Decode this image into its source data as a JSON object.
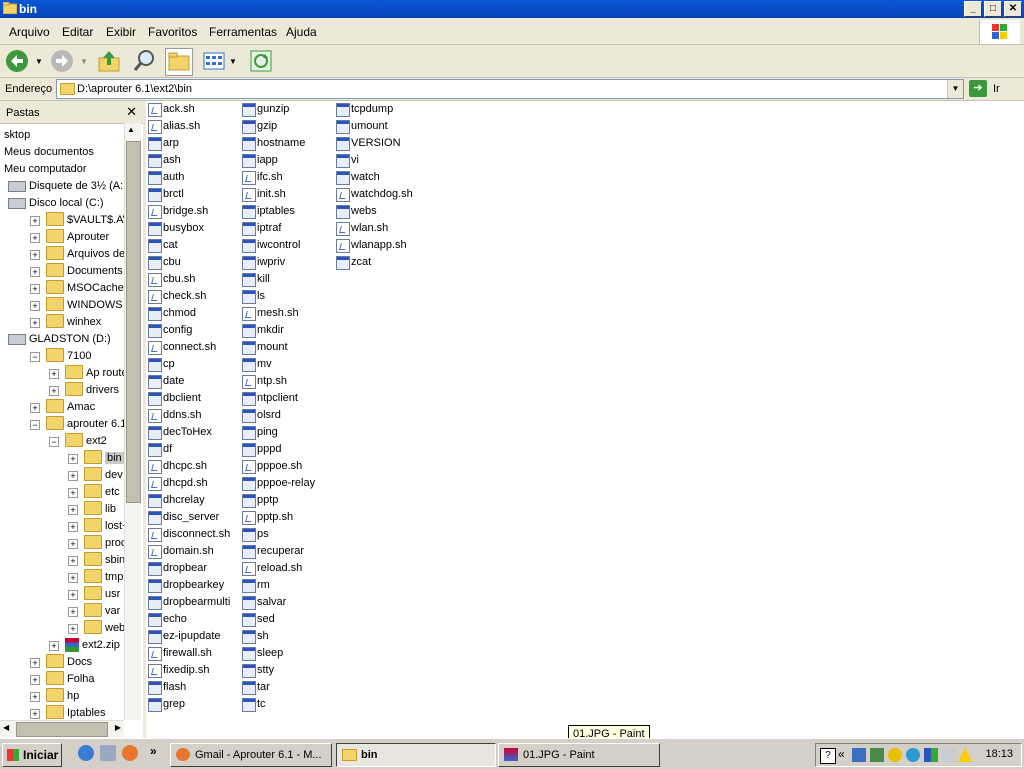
{
  "window": {
    "title": "bin",
    "btn_min": "_",
    "btn_max": "□",
    "btn_close": "✕"
  },
  "menu": [
    "Arquivo",
    "Editar",
    "Exibir",
    "Favoritos",
    "Ferramentas",
    "Ajuda"
  ],
  "address": {
    "label": "Endereço",
    "value": "D:\\aprouter 6.1\\ext2\\bin",
    "go_label": "Ir",
    "go_arrow": "➔"
  },
  "folders_pane": {
    "title": "Pastas",
    "close": "✕"
  },
  "tree": [
    {
      "label": "sktop",
      "indent": 0,
      "icon": "none",
      "exp": ""
    },
    {
      "label": "Meus documentos",
      "indent": 0,
      "icon": "none",
      "exp": ""
    },
    {
      "label": "Meu computador",
      "indent": 0,
      "icon": "none",
      "exp": ""
    },
    {
      "label": "Disquete de 3½ (A:",
      "indent": 1,
      "icon": "drive",
      "exp": ""
    },
    {
      "label": "Disco local (C:)",
      "indent": 1,
      "icon": "drive",
      "exp": ""
    },
    {
      "label": "$VAULT$.AVG",
      "indent": 2,
      "icon": "folder",
      "exp": "+"
    },
    {
      "label": "Aprouter",
      "indent": 2,
      "icon": "folder",
      "exp": "+"
    },
    {
      "label": "Arquivos de pro",
      "indent": 2,
      "icon": "folder",
      "exp": "+"
    },
    {
      "label": "Documents and",
      "indent": 2,
      "icon": "folder",
      "exp": "+"
    },
    {
      "label": "MSOCache",
      "indent": 2,
      "icon": "folder",
      "exp": "+"
    },
    {
      "label": "WINDOWS",
      "indent": 2,
      "icon": "folder",
      "exp": "+"
    },
    {
      "label": "winhex",
      "indent": 2,
      "icon": "folder",
      "exp": "+"
    },
    {
      "label": "GLADSTON (D:)",
      "indent": 1,
      "icon": "drive",
      "exp": ""
    },
    {
      "label": "7100",
      "indent": 2,
      "icon": "folder",
      "exp": "−"
    },
    {
      "label": "Ap router",
      "indent": 3,
      "icon": "folder",
      "exp": "+"
    },
    {
      "label": "drivers",
      "indent": 3,
      "icon": "folder",
      "exp": "+"
    },
    {
      "label": "Amac",
      "indent": 2,
      "icon": "folder",
      "exp": "+"
    },
    {
      "label": "aprouter 6.1",
      "indent": 2,
      "icon": "folder",
      "exp": "−"
    },
    {
      "label": "ext2",
      "indent": 3,
      "icon": "folder",
      "exp": "−"
    },
    {
      "label": "bin",
      "indent": 4,
      "icon": "folder",
      "exp": "+",
      "selected": true
    },
    {
      "label": "dev",
      "indent": 4,
      "icon": "folder",
      "exp": "+"
    },
    {
      "label": "etc",
      "indent": 4,
      "icon": "folder",
      "exp": "+"
    },
    {
      "label": "lib",
      "indent": 4,
      "icon": "folder",
      "exp": "+"
    },
    {
      "label": "lost+fou",
      "indent": 4,
      "icon": "folder",
      "exp": "+"
    },
    {
      "label": "proc",
      "indent": 4,
      "icon": "folder",
      "exp": "+"
    },
    {
      "label": "sbin",
      "indent": 4,
      "icon": "folder",
      "exp": "+"
    },
    {
      "label": "tmp",
      "indent": 4,
      "icon": "folder",
      "exp": "+"
    },
    {
      "label": "usr",
      "indent": 4,
      "icon": "folder",
      "exp": "+"
    },
    {
      "label": "var",
      "indent": 4,
      "icon": "folder",
      "exp": "+"
    },
    {
      "label": "web",
      "indent": 4,
      "icon": "folder",
      "exp": "+"
    },
    {
      "label": "ext2.zip",
      "indent": 3,
      "icon": "zip",
      "exp": "+"
    },
    {
      "label": "Docs",
      "indent": 2,
      "icon": "folder",
      "exp": "+"
    },
    {
      "label": "Folha",
      "indent": 2,
      "icon": "folder",
      "exp": "+"
    },
    {
      "label": "hp",
      "indent": 2,
      "icon": "folder",
      "exp": "+"
    },
    {
      "label": "Iptables",
      "indent": 2,
      "icon": "folder",
      "exp": "+"
    }
  ],
  "files": [
    [
      {
        "name": "ack.sh",
        "type": "sh"
      },
      {
        "name": "alias.sh",
        "type": "sh"
      },
      {
        "name": "arp",
        "type": "exe"
      },
      {
        "name": "ash",
        "type": "exe"
      },
      {
        "name": "auth",
        "type": "exe"
      },
      {
        "name": "brctl",
        "type": "exe"
      },
      {
        "name": "bridge.sh",
        "type": "sh"
      },
      {
        "name": "busybox",
        "type": "exe"
      },
      {
        "name": "cat",
        "type": "exe"
      },
      {
        "name": "cbu",
        "type": "exe"
      },
      {
        "name": "cbu.sh",
        "type": "sh"
      },
      {
        "name": "check.sh",
        "type": "sh"
      },
      {
        "name": "chmod",
        "type": "exe"
      },
      {
        "name": "config",
        "type": "exe"
      },
      {
        "name": "connect.sh",
        "type": "sh"
      },
      {
        "name": "cp",
        "type": "exe"
      },
      {
        "name": "date",
        "type": "exe"
      },
      {
        "name": "dbclient",
        "type": "exe"
      },
      {
        "name": "ddns.sh",
        "type": "sh"
      },
      {
        "name": "decToHex",
        "type": "exe"
      },
      {
        "name": "df",
        "type": "exe"
      },
      {
        "name": "dhcpc.sh",
        "type": "sh"
      },
      {
        "name": "dhcpd.sh",
        "type": "sh"
      },
      {
        "name": "dhcrelay",
        "type": "exe"
      },
      {
        "name": "disc_server",
        "type": "exe"
      },
      {
        "name": "disconnect.sh",
        "type": "sh"
      },
      {
        "name": "domain.sh",
        "type": "sh"
      },
      {
        "name": "dropbear",
        "type": "exe"
      },
      {
        "name": "dropbearkey",
        "type": "exe"
      },
      {
        "name": "dropbearmulti",
        "type": "exe"
      },
      {
        "name": "echo",
        "type": "exe"
      },
      {
        "name": "ez-ipupdate",
        "type": "exe"
      },
      {
        "name": "firewall.sh",
        "type": "sh"
      },
      {
        "name": "fixedip.sh",
        "type": "sh"
      },
      {
        "name": "flash",
        "type": "exe"
      },
      {
        "name": "grep",
        "type": "exe"
      }
    ],
    [
      {
        "name": "gunzip",
        "type": "exe"
      },
      {
        "name": "gzip",
        "type": "exe"
      },
      {
        "name": "hostname",
        "type": "exe"
      },
      {
        "name": "iapp",
        "type": "exe"
      },
      {
        "name": "ifc.sh",
        "type": "sh"
      },
      {
        "name": "init.sh",
        "type": "sh"
      },
      {
        "name": "iptables",
        "type": "exe"
      },
      {
        "name": "iptraf",
        "type": "exe"
      },
      {
        "name": "iwcontrol",
        "type": "exe"
      },
      {
        "name": "iwpriv",
        "type": "exe"
      },
      {
        "name": "kill",
        "type": "exe"
      },
      {
        "name": "ls",
        "type": "exe"
      },
      {
        "name": "mesh.sh",
        "type": "sh"
      },
      {
        "name": "mkdir",
        "type": "exe"
      },
      {
        "name": "mount",
        "type": "exe"
      },
      {
        "name": "mv",
        "type": "exe"
      },
      {
        "name": "ntp.sh",
        "type": "sh"
      },
      {
        "name": "ntpclient",
        "type": "exe"
      },
      {
        "name": "olsrd",
        "type": "exe"
      },
      {
        "name": "ping",
        "type": "exe"
      },
      {
        "name": "pppd",
        "type": "exe"
      },
      {
        "name": "pppoe.sh",
        "type": "sh"
      },
      {
        "name": "pppoe-relay",
        "type": "exe"
      },
      {
        "name": "pptp",
        "type": "exe"
      },
      {
        "name": "pptp.sh",
        "type": "sh"
      },
      {
        "name": "ps",
        "type": "exe"
      },
      {
        "name": "recuperar",
        "type": "exe"
      },
      {
        "name": "reload.sh",
        "type": "sh"
      },
      {
        "name": "rm",
        "type": "exe"
      },
      {
        "name": "salvar",
        "type": "exe"
      },
      {
        "name": "sed",
        "type": "exe"
      },
      {
        "name": "sh",
        "type": "exe"
      },
      {
        "name": "sleep",
        "type": "exe"
      },
      {
        "name": "stty",
        "type": "exe"
      },
      {
        "name": "tar",
        "type": "exe"
      },
      {
        "name": "tc",
        "type": "exe"
      }
    ],
    [
      {
        "name": "tcpdump",
        "type": "exe"
      },
      {
        "name": "umount",
        "type": "exe"
      },
      {
        "name": "VERSION",
        "type": "exe"
      },
      {
        "name": "vi",
        "type": "exe"
      },
      {
        "name": "watch",
        "type": "exe"
      },
      {
        "name": "watchdog.sh",
        "type": "sh"
      },
      {
        "name": "webs",
        "type": "exe"
      },
      {
        "name": "wlan.sh",
        "type": "sh"
      },
      {
        "name": "wlanapp.sh",
        "type": "sh"
      },
      {
        "name": "zcat",
        "type": "exe"
      }
    ]
  ],
  "tooltip": "01.JPG - Paint",
  "taskbar": {
    "start": "Iniciar",
    "more": "»",
    "tasks": [
      {
        "label": "Gmail - Aprouter 6.1 - M...",
        "active": false
      },
      {
        "label": "bin",
        "active": true
      },
      {
        "label": "01.JPG - Paint",
        "active": false
      }
    ],
    "tray_collapse": "«",
    "clock": "18:13"
  },
  "colors": {
    "titlebar": "#0a58d8",
    "selection": "#c8c8c8",
    "taskbar": "#d4d0c8"
  }
}
